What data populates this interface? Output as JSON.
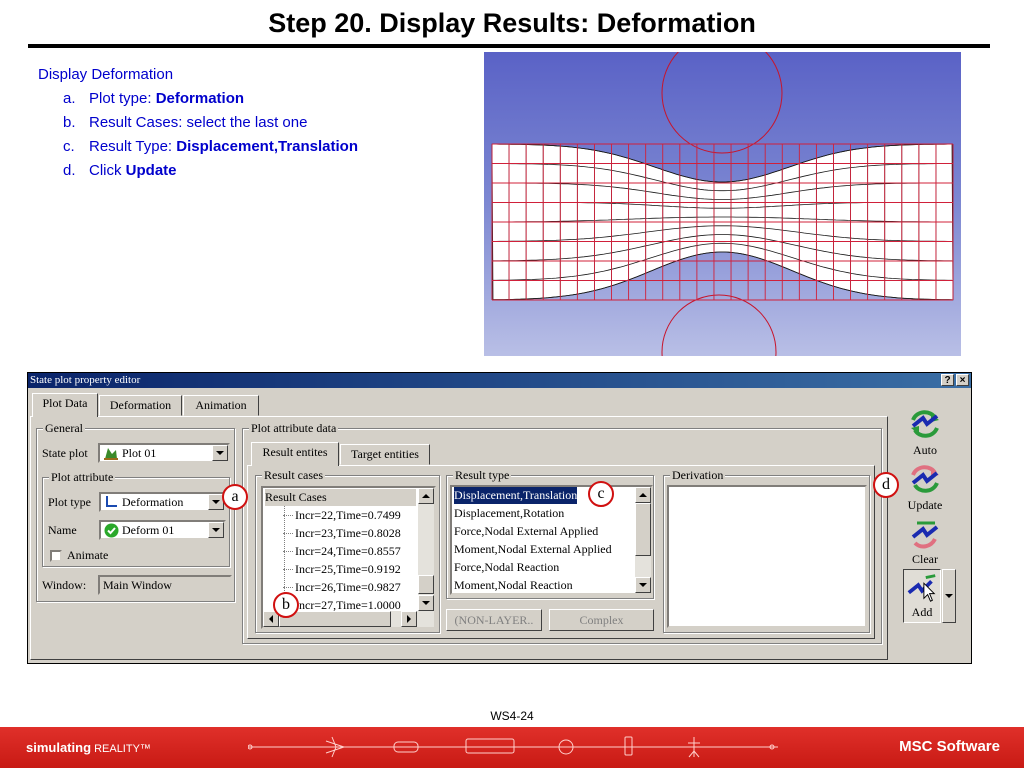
{
  "slide": {
    "title": "Step 20. Display Results: Deformation",
    "heading": "Display Deformation",
    "steps": [
      {
        "letter": "a.",
        "text": "Plot type: ",
        "bold": "Deformation"
      },
      {
        "letter": "b.",
        "text": "Result Cases: select the last one",
        "bold": ""
      },
      {
        "letter": "c.",
        "text": "Result Type: ",
        "bold": "Displacement,Translation"
      },
      {
        "letter": "d.",
        "text": "Click ",
        "bold": "Update"
      }
    ],
    "page_id": "WS4-24",
    "footer_left_bold": "simulating",
    "footer_left_rest": " REALITY™",
    "footer_right": "MSC Software"
  },
  "dialog": {
    "title": "State plot property editor",
    "help_label": "?",
    "close_label": "×",
    "tabs": [
      "Plot Data",
      "Deformation",
      "Animation"
    ],
    "general": {
      "legend": "General",
      "state_plot_label": "State plot",
      "state_plot_value": "Plot 01",
      "plot_attribute_legend": "Plot attribute",
      "plot_type_label": "Plot type",
      "plot_type_value": "Deformation",
      "name_label": "Name",
      "name_value": "Deform 01",
      "animate_label": "Animate",
      "window_label": "Window:",
      "window_value": "Main Window"
    },
    "plot_attribute_data": {
      "legend": "Plot attribute data",
      "tabs": [
        "Result entites",
        "Target entities"
      ],
      "result_cases": {
        "legend": "Result cases",
        "root": "Result Cases",
        "items": [
          "Incr=22,Time=0.7499",
          "Incr=23,Time=0.8028",
          "Incr=24,Time=0.8557",
          "Incr=25,Time=0.9192",
          "Incr=26,Time=0.9827",
          "Incr=27,Time=1.0000"
        ],
        "selected_index": 5
      },
      "result_type": {
        "legend": "Result type",
        "items": [
          "Displacement,Translation",
          "Displacement,Rotation",
          "Force,Nodal External Applied",
          "Moment,Nodal External Applied",
          "Force,Nodal Reaction",
          "Moment,Nodal Reaction"
        ],
        "selected_index": 0
      },
      "derivation": {
        "legend": "Derivation"
      },
      "buttons": {
        "non_layer": "(NON-LAYER..",
        "complex": "Complex"
      }
    },
    "toolbar": {
      "auto": "Auto",
      "update": "Update",
      "clear": "Clear",
      "add": "Add"
    }
  },
  "callouts": {
    "a": "a",
    "b": "b",
    "c": "c",
    "d": "d"
  },
  "colors": {
    "selection": "#0a246a",
    "callout": "#d01010",
    "footer": "#d0201a",
    "viewport_top": "#5a62c6",
    "viewport_bottom": "#b9bfe6",
    "mesh": "#d0203a"
  }
}
